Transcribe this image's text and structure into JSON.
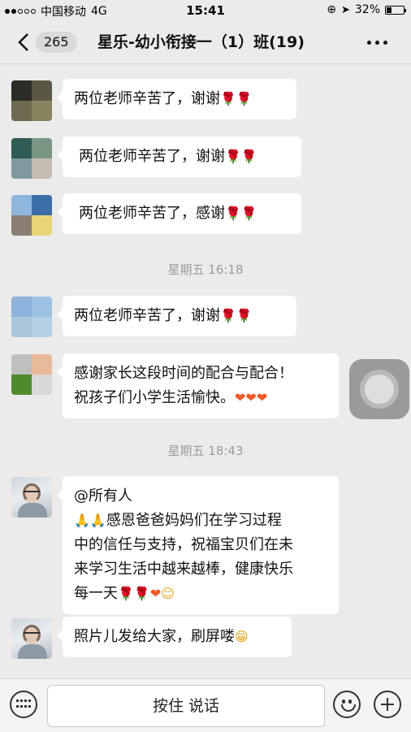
{
  "status_bar": {
    "carrier": "中国移动",
    "network": "4G",
    "time": "15:41",
    "battery": "32%",
    "battery_level": 0.32
  },
  "nav": {
    "unread_count": "265",
    "title": "星乐-幼小衔接一（1）班(19)"
  },
  "messages": [
    {
      "text_lines": [
        "两位老师辛苦了，谢谢"
      ],
      "emoji": [
        "rose-emoji",
        "rose-emoji"
      ],
      "avatar_colors": [
        "#2b2c25",
        "#5a5747",
        "#6d6a4f",
        "#8a8360"
      ]
    },
    {
      "text_lines": [
        "两位老师辛苦了，谢谢"
      ],
      "emoji": [
        "rose-emoji",
        "rose-emoji"
      ],
      "avatar_colors": [
        "#2f5c55",
        "#7a9683",
        "#7e9a9f",
        "#c4bcb0"
      ]
    },
    {
      "text_lines": [
        "两位老师辛苦了，感谢"
      ],
      "emoji": [
        "rose-emoji",
        "rose-emoji"
      ],
      "avatar_colors": [
        "#8fb7de",
        "#3c6ea8",
        "#8a7f72",
        "#e8d57a"
      ]
    },
    {
      "text_lines": [
        "两位老师辛苦了，谢谢"
      ],
      "emoji": [
        "rose-emoji",
        "rose-emoji"
      ],
      "avatar_colors": [
        "#8db3dd",
        "#9cc1e3",
        "#a9c6dd",
        "#b3cfe5"
      ]
    },
    {
      "text_lines": [
        "感谢家长这段时间的配合与配合！",
        "祝孩子们小学生活愉快。"
      ],
      "emoji": [
        "heart-emoji",
        "heart-emoji",
        "heart-emoji"
      ],
      "avatar_colors": [
        "#bfbfbf",
        "#e7b89a",
        "#4f8b2c",
        "#d8d8d8"
      ]
    },
    {
      "text_lines": [
        "@所有人",
        "感恩爸爸妈妈们在学习过程",
        "中的信任与支持，祝福宝贝们在未",
        "来学习生活中越来越棒，健康快乐",
        "每一天"
      ],
      "lead_emoji": [
        "pray-emoji",
        "pray-emoji"
      ],
      "emoji": [
        "rose-emoji",
        "rose-emoji",
        "heart-emoji",
        "smile-emoji"
      ]
    },
    {
      "text_lines": [
        "照片儿发给大家，刷屏喽"
      ],
      "emoji": [
        "grin-emoji"
      ]
    }
  ],
  "timestamps": [
    "星期五 16:18",
    "星期五 18:43"
  ],
  "input_bar": {
    "hold_to_talk_label": "按住 说话"
  }
}
